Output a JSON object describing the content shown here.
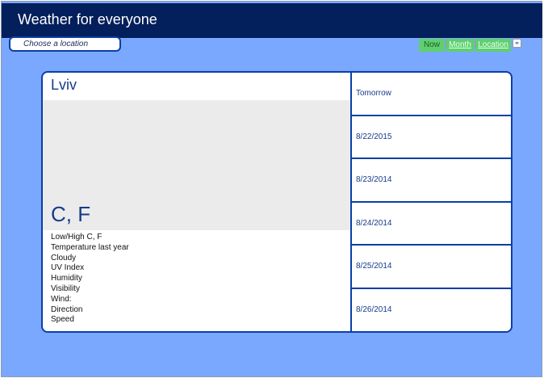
{
  "header": {
    "title": "Weather for everyone"
  },
  "location": {
    "placeholder": "Choose a location"
  },
  "nav": {
    "now_label": "Now",
    "month_label": "Month",
    "location_label": "Location"
  },
  "main": {
    "city": "Lviv",
    "temperature": "C, F",
    "details": [
      "Low/High C, F",
      "Temperature last year",
      "Cloudy",
      "UV Index",
      "Humidity",
      "Visibility",
      "Wind:",
      "Direction",
      "Speed"
    ]
  },
  "days": [
    "Tomorrow",
    "8/22/2015",
    "8/23/2014",
    "8/24/2014",
    "8/25/2014",
    "8/26/2014"
  ],
  "colors": {
    "header_bg": "#031f5c",
    "page_bg": "#7aa8ff",
    "accent": "#0b3fa6",
    "nav_green": "#5fcf6f"
  },
  "icons": {
    "link": "link-icon"
  }
}
